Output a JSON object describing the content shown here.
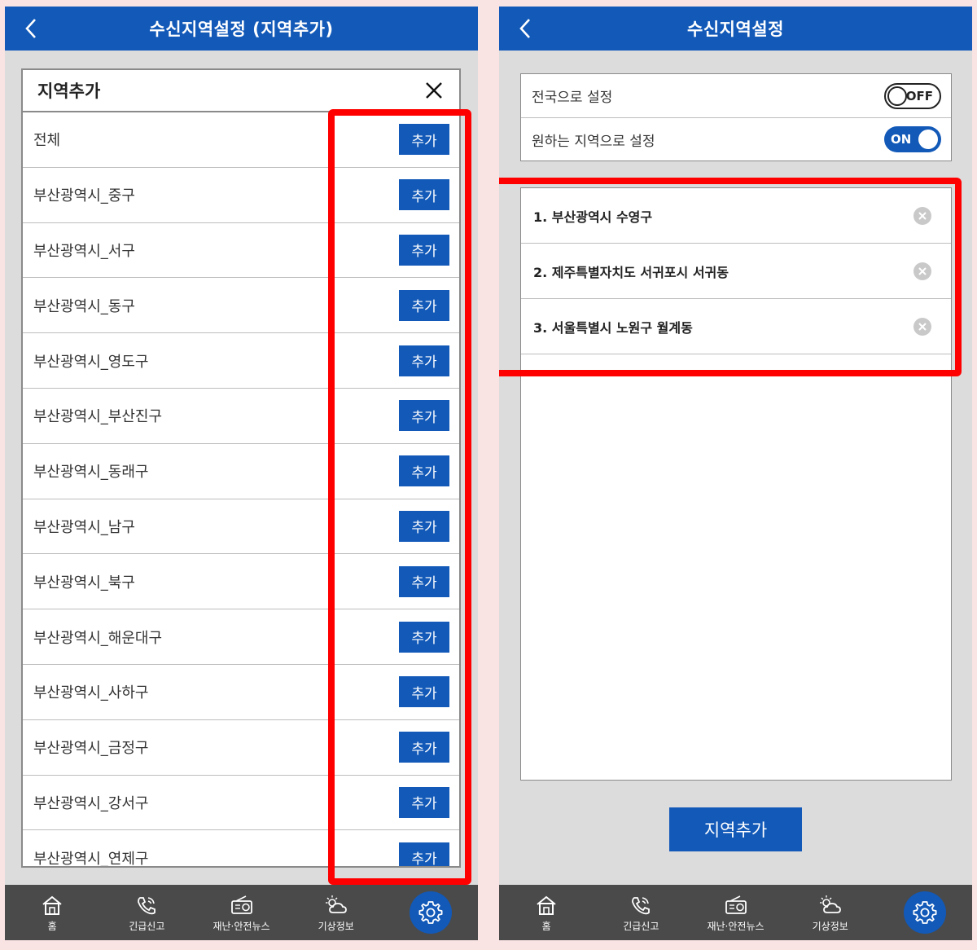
{
  "left_screen": {
    "title": "수신지역설정 (지역추가)",
    "dialog_title": "지역추가",
    "add_label": "추가",
    "regions": [
      "전체",
      "부산광역시_중구",
      "부산광역시_서구",
      "부산광역시_동구",
      "부산광역시_영도구",
      "부산광역시_부산진구",
      "부산광역시_동래구",
      "부산광역시_남구",
      "부산광역시_북구",
      "부산광역시_해운대구",
      "부산광역시_사하구",
      "부산광역시_금정구",
      "부산광역시_강서구",
      "부산광역시_연제구"
    ]
  },
  "right_screen": {
    "title": "수신지역설정",
    "settings": [
      {
        "label": "전국으로 설정",
        "toggle": "OFF"
      },
      {
        "label": "원하는 지역으로 설정",
        "toggle": "ON"
      }
    ],
    "selected_regions": [
      "1. 부산광역시 수영구",
      "2. 제주특별자치도 서귀포시 서귀동",
      "3. 서울특별시 노원구 월계동"
    ],
    "add_region_button": "지역추가"
  },
  "nav": {
    "home": "홈",
    "emergency": "긴급신고",
    "news": "재난·안전뉴스",
    "weather": "기상정보"
  },
  "colors": {
    "primary": "#1259b8",
    "highlight": "#ff0000",
    "nav_bg": "#4a4a4a",
    "screen_bg": "#dcdcdc",
    "page_bg": "#f9e3e3"
  }
}
